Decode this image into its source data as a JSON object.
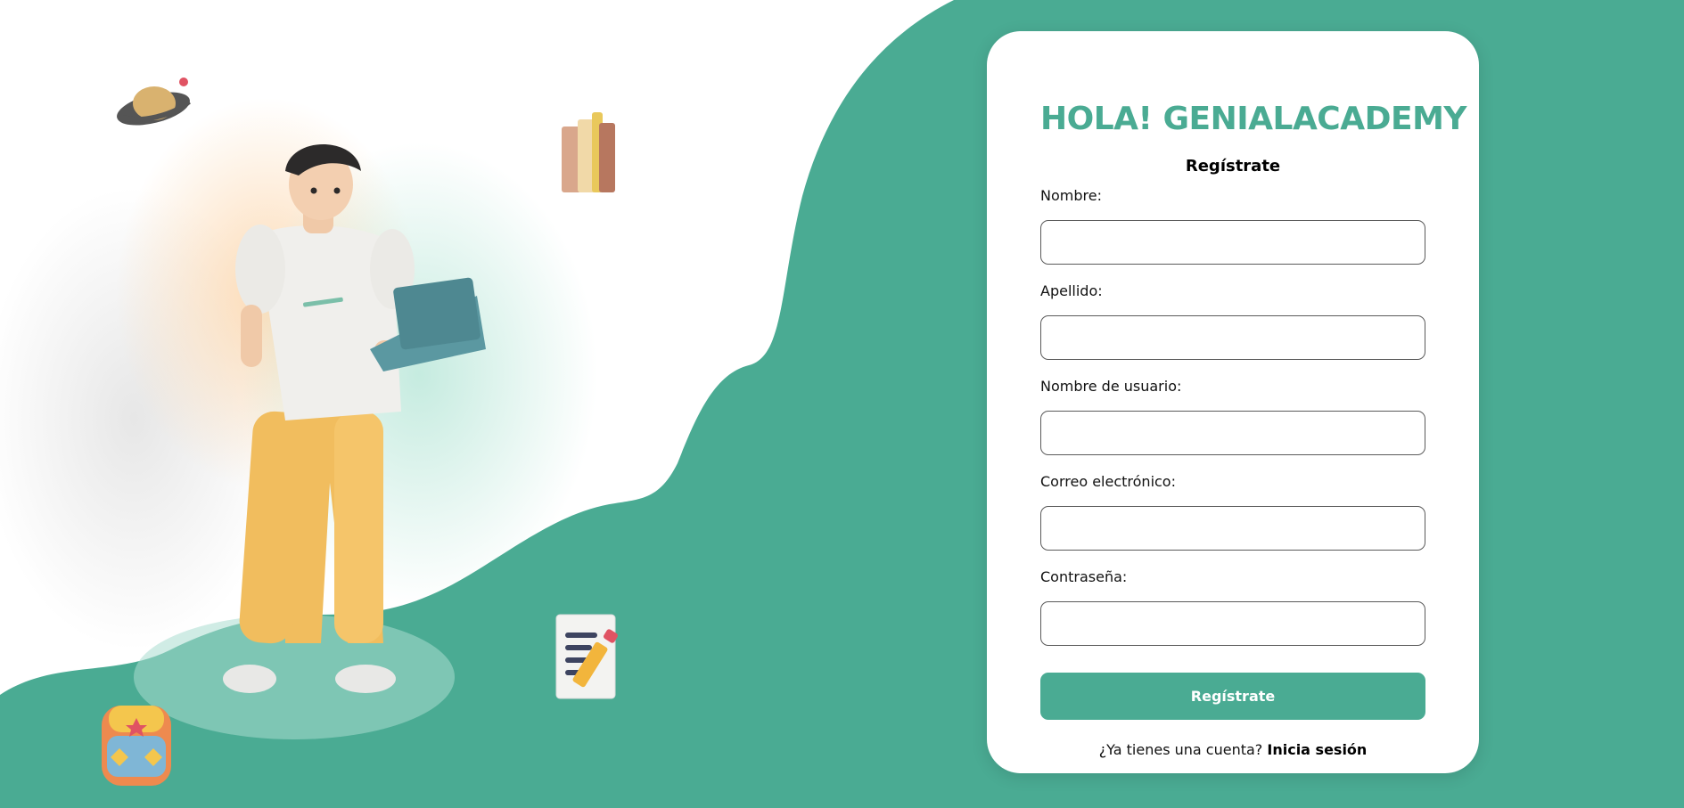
{
  "colors": {
    "brand": "#4aab93",
    "background": "#ffffff"
  },
  "illustration": {
    "icons": [
      "planet-icon",
      "books-icon",
      "student-with-tablet-illustration",
      "notepad-pencil-icon",
      "backpack-icon"
    ]
  },
  "form": {
    "title": "HOLA! GENIALACADEMY",
    "subtitle": "Regístrate",
    "fields": [
      {
        "label": "Nombre:",
        "value": "",
        "placeholder": ""
      },
      {
        "label": "Apellido:",
        "value": "",
        "placeholder": ""
      },
      {
        "label": "Nombre de usuario:",
        "value": "",
        "placeholder": ""
      },
      {
        "label": "Correo electrónico:",
        "value": "",
        "placeholder": ""
      },
      {
        "label": "Contraseña:",
        "value": "",
        "placeholder": ""
      }
    ],
    "submit_label": "Regístrate",
    "login_prompt": "¿Ya tienes una cuenta?",
    "login_link": "Inicia sesión"
  }
}
